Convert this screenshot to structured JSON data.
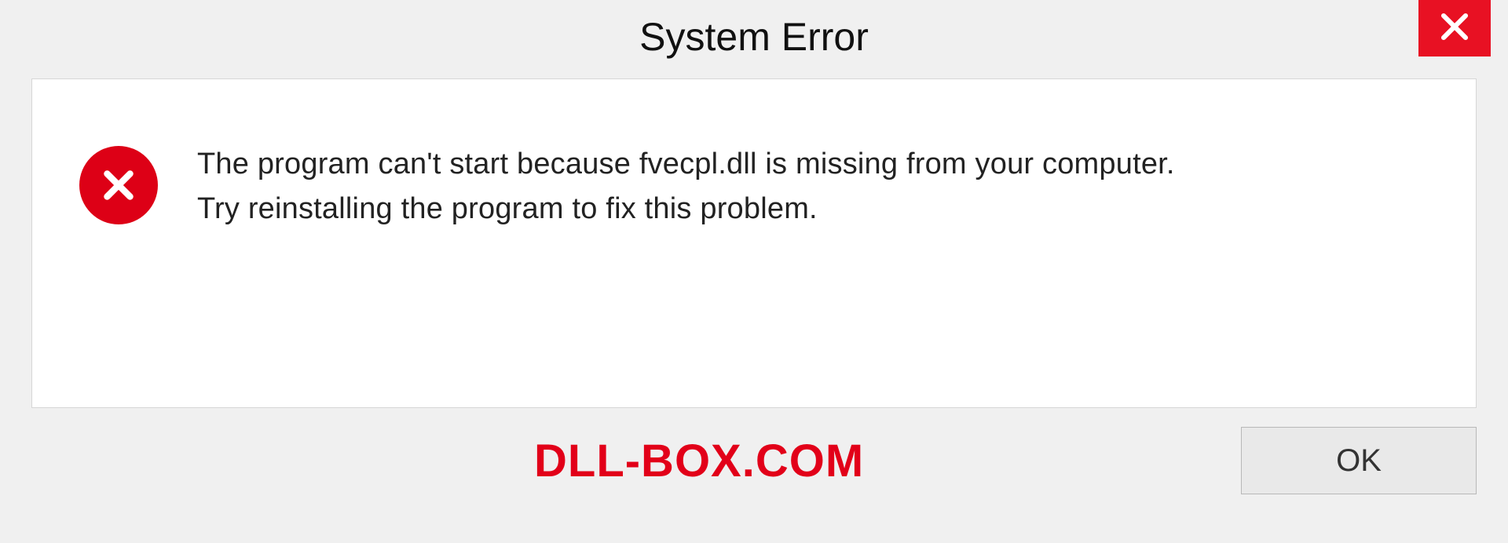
{
  "dialog": {
    "title": "System Error",
    "message_line1": "The program can't start because fvecpl.dll is missing from your computer.",
    "message_line2": "Try reinstalling the program to fix this problem.",
    "ok_label": "OK"
  },
  "watermark": "DLL-BOX.COM",
  "colors": {
    "accent_red": "#e81123",
    "error_red": "#dd0016",
    "watermark_red": "#e20019"
  }
}
